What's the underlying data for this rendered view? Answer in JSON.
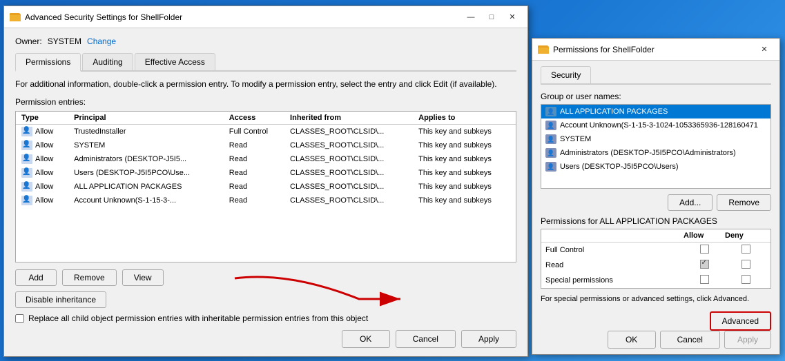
{
  "main_dialog": {
    "title": "Advanced Security Settings for ShellFolder",
    "owner_label": "Owner:",
    "owner_value": "SYSTEM",
    "owner_change": "Change",
    "tabs": [
      {
        "label": "Permissions",
        "active": true
      },
      {
        "label": "Auditing",
        "active": false
      },
      {
        "label": "Effective Access",
        "active": false
      }
    ],
    "info_text": "For additional information, double-click a permission entry. To modify a permission entry, select the entry and click Edit (if available).",
    "section_label": "Permission entries:",
    "table_headers": [
      "Type",
      "Principal",
      "Access",
      "Inherited from",
      "Applies to"
    ],
    "table_rows": [
      {
        "type": "Allow",
        "principal": "TrustedInstaller",
        "access": "Full Control",
        "inherited": "CLASSES_ROOT\\CLSID\\...",
        "applies": "This key and subkeys"
      },
      {
        "type": "Allow",
        "principal": "SYSTEM",
        "access": "Read",
        "inherited": "CLASSES_ROOT\\CLSID\\...",
        "applies": "This key and subkeys"
      },
      {
        "type": "Allow",
        "principal": "Administrators (DESKTOP-J5I5...",
        "access": "Read",
        "inherited": "CLASSES_ROOT\\CLSID\\...",
        "applies": "This key and subkeys"
      },
      {
        "type": "Allow",
        "principal": "Users (DESKTOP-J5I5PCO\\Use...",
        "access": "Read",
        "inherited": "CLASSES_ROOT\\CLSID\\...",
        "applies": "This key and subkeys"
      },
      {
        "type": "Allow",
        "principal": "ALL APPLICATION PACKAGES",
        "access": "Read",
        "inherited": "CLASSES_ROOT\\CLSID\\...",
        "applies": "This key and subkeys"
      },
      {
        "type": "Allow",
        "principal": "Account Unknown(S-1-15-3-...",
        "access": "Read",
        "inherited": "CLASSES_ROOT\\CLSID\\...",
        "applies": "This key and subkeys"
      }
    ],
    "buttons": {
      "add": "Add",
      "remove": "Remove",
      "view": "View",
      "disable_inheritance": "Disable inheritance",
      "ok": "OK",
      "cancel": "Cancel",
      "apply": "Apply"
    },
    "checkbox_label": "Replace all child object permission entries with inheritable permission entries from this object"
  },
  "second_dialog": {
    "title": "Permissions for ShellFolder",
    "tab": "Security",
    "group_label": "Group or user names:",
    "users": [
      {
        "name": "ALL APPLICATION PACKAGES",
        "type": "app",
        "selected": true
      },
      {
        "name": "Account Unknown(S-1-15-3-1024-1053365936-128160471",
        "type": "user",
        "selected": false
      },
      {
        "name": "SYSTEM",
        "type": "user",
        "selected": false
      },
      {
        "name": "Administrators (DESKTOP-J5I5PCO\\Administrators)",
        "type": "group",
        "selected": false
      },
      {
        "name": "Users (DESKTOP-J5I5PCO\\Users)",
        "type": "group",
        "selected": false
      }
    ],
    "add_btn": "Add...",
    "remove_btn": "Remove",
    "perms_label": "Permissions for ALL APPLICATION PACKAGES",
    "perms_columns": [
      "",
      "Allow",
      "Deny"
    ],
    "permissions": [
      {
        "name": "Full Control",
        "allow": false,
        "deny": false,
        "allow_grayed": false
      },
      {
        "name": "Read",
        "allow": true,
        "deny": false,
        "allow_grayed": true
      },
      {
        "name": "Special permissions",
        "allow": false,
        "deny": false,
        "allow_grayed": false
      }
    ],
    "special_text": "For special permissions or advanced settings, click Advanced.",
    "advanced_btn": "Advanced",
    "buttons": {
      "ok": "OK",
      "cancel": "Cancel",
      "apply": "Apply"
    }
  }
}
